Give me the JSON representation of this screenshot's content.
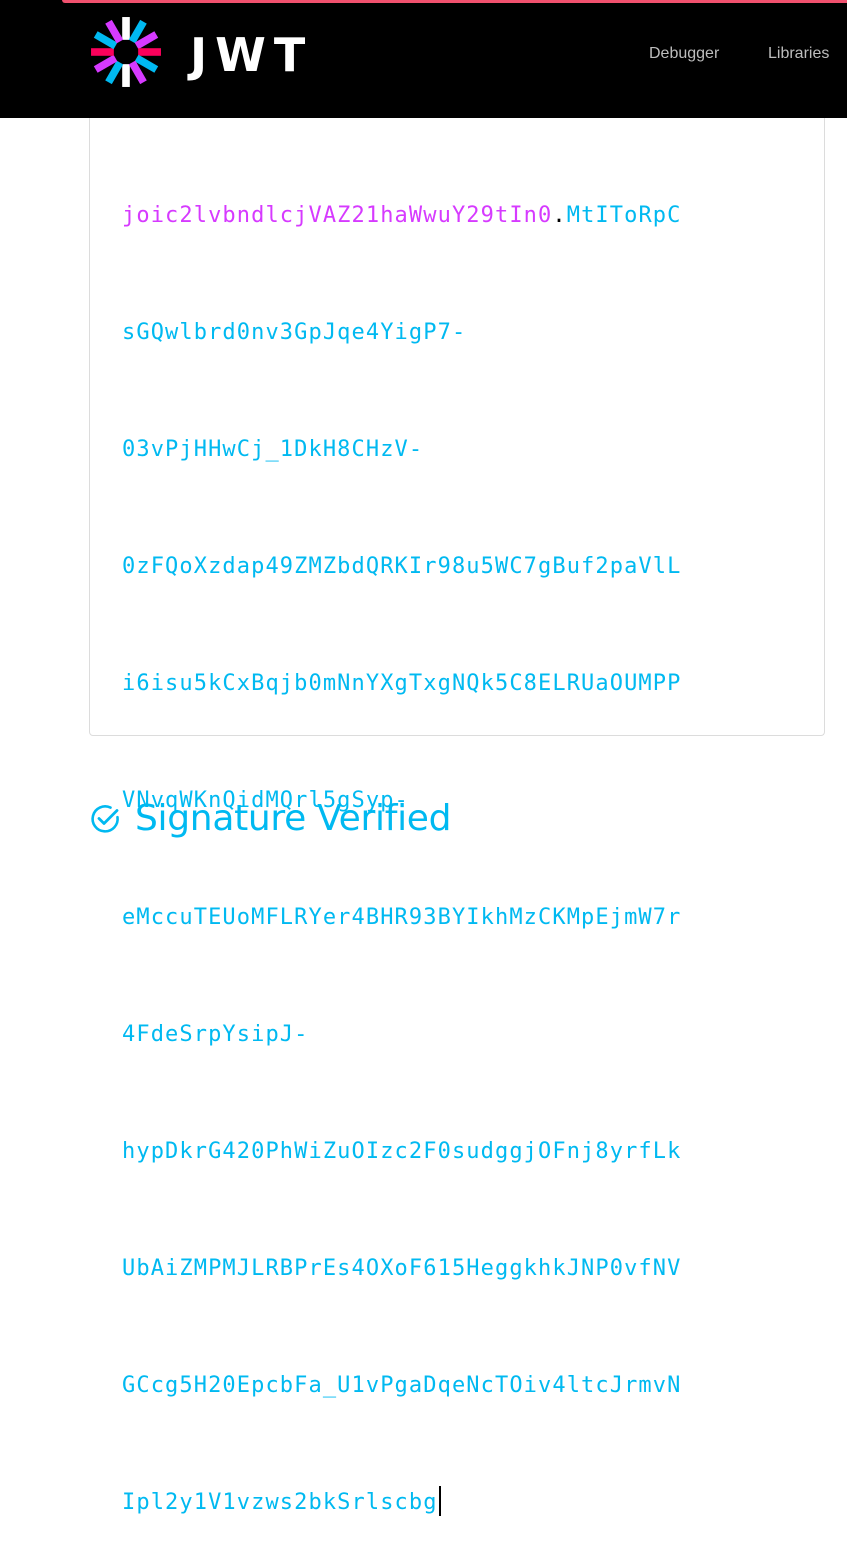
{
  "navbar": {
    "brand": "JWT",
    "links": [
      {
        "label": "Debugger"
      },
      {
        "label": "Libraries"
      }
    ],
    "logo_colors": [
      "#ffffff",
      "#00b9f1",
      "#d63aff",
      "#fb015b"
    ]
  },
  "token": {
    "lines": [
      {
        "payload": "joic2lvbndlcjVAZ21haWwuY29tIn0",
        "dot": ".",
        "sig": "MtIToRpC"
      },
      {
        "sig": "sGQwlbrd0nv3GpJqe4YigP7-"
      },
      {
        "sig": "03vPjHHwCj_1DkH8CHzV-"
      },
      {
        "sig": "0zFQoXzdap49ZMZbdQRKIr98u5WC7gBuf2paVlL"
      },
      {
        "sig": "i6isu5kCxBqjb0mNnYXgTxgNQk5C8ELRUaOUMPP"
      },
      {
        "sig": "VNvqWKnQidMQrl5gSyp-"
      },
      {
        "sig": "eMccuTEUoMFLRYer4BHR93BYIkhMzCKMpEjmW7r"
      },
      {
        "sig": "4FdeSrpYsipJ-"
      },
      {
        "sig": "hypDkrG420PhWiZuOIzc2F0sudggjOFnj8yrfLk"
      },
      {
        "sig": "UbAiZMPMJLRBPrEs4OXoF615HeggkhkJNP0vfNV"
      },
      {
        "sig": "GCcg5H20EpcbFa_U1vPgaDqeNcTOiv4ltcJrmvN"
      },
      {
        "sig": "Ipl2y1V1vzws2bkSrlscbg"
      }
    ],
    "colors": {
      "payload": "#d63aff",
      "signature": "#00b9f1"
    }
  },
  "verification": {
    "label": "Signature Verified",
    "icon": "check-circle-icon",
    "color": "#00b9f1"
  }
}
